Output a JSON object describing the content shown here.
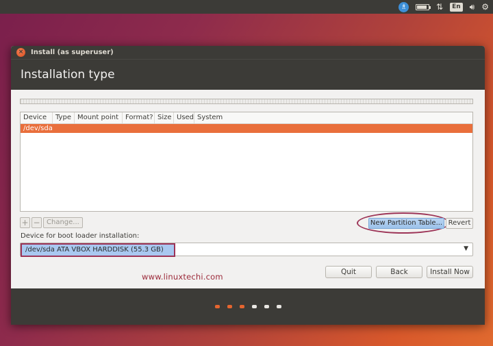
{
  "top_panel": {
    "icons": [
      "accessibility-icon",
      "battery-icon",
      "network-arrows-icon",
      "keyboard-language-icon",
      "volume-icon",
      "settings-gear-icon"
    ],
    "language": "En"
  },
  "window": {
    "title": "Install (as superuser)",
    "header": "Installation type"
  },
  "partition_table": {
    "columns": [
      "Device",
      "Type",
      "Mount point",
      "Format?",
      "Size",
      "Used",
      "System"
    ],
    "rows": [
      {
        "device": "/dev/sda"
      }
    ],
    "selected_row_color": "#e96f3c"
  },
  "table_buttons": {
    "add": "+",
    "remove": "−",
    "change": "Change..."
  },
  "new_partition_table_button": "New Partition Table...",
  "revert_button": "Revert",
  "boot_loader": {
    "label": "Device for boot loader installation:",
    "selected": "/dev/sda ATA VBOX HARDDISK (55.3 GB)"
  },
  "watermark": "www.linuxtechi.com",
  "actions": {
    "quit": "Quit",
    "back": "Back",
    "install_now": "Install Now"
  },
  "progress": {
    "total_steps": 6,
    "completed_steps": 3,
    "active_color": "#e5652f"
  }
}
